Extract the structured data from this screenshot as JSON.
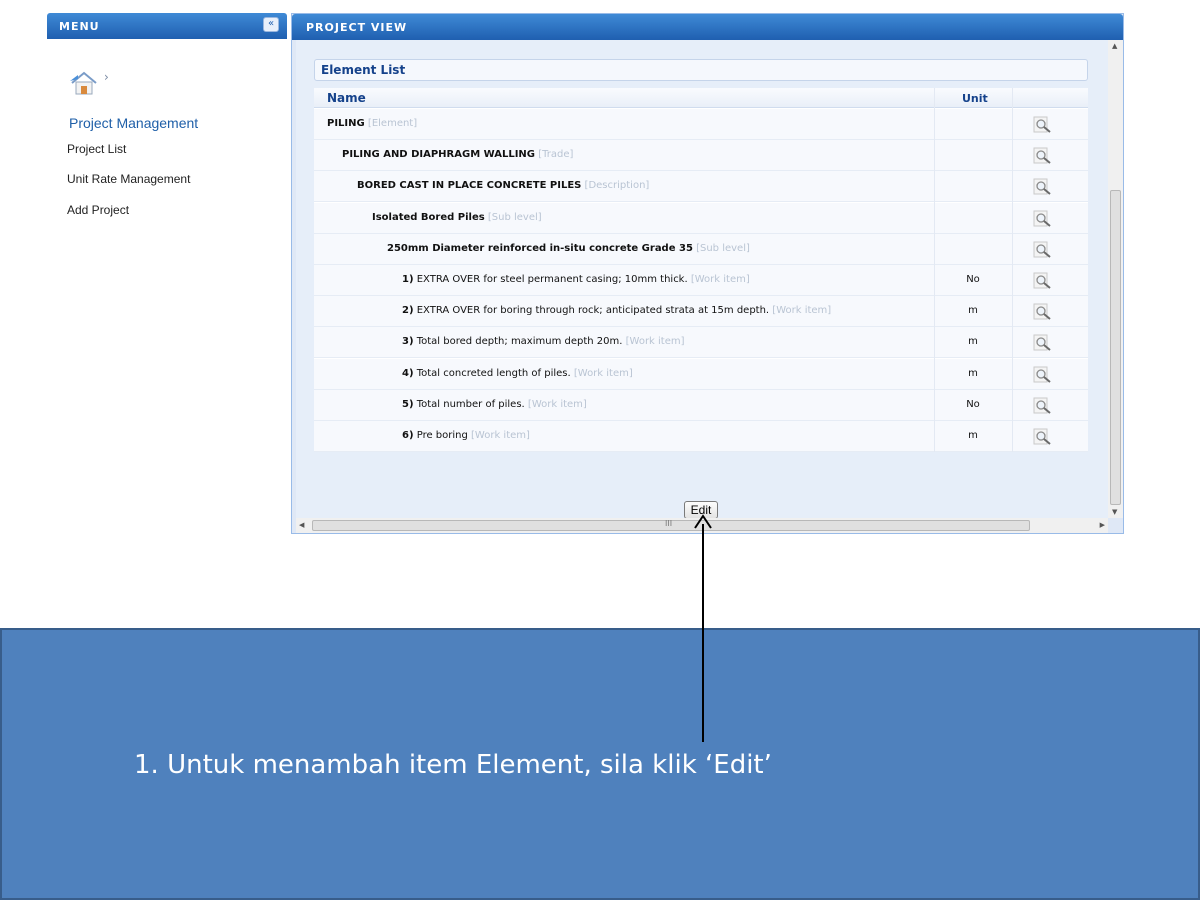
{
  "menu": {
    "title": "MENU",
    "collapse_icon": "double-chevron-left-icon",
    "home_icon": "home-icon",
    "home_chevron": "›",
    "section": "Project Management",
    "links": [
      "Project List",
      "Unit Rate Management",
      "Add Project"
    ]
  },
  "project_view": {
    "title": "PROJECT VIEW",
    "element_list_title": "Element List",
    "columns": {
      "name": "Name",
      "unit": "Unit"
    },
    "rows": [
      {
        "prefix": "",
        "name": "PILING",
        "tag": "[Element]",
        "unit": "",
        "bold": true,
        "level": 0
      },
      {
        "prefix": "",
        "name": "PILING AND DIAPHRAGM WALLING",
        "tag": "[Trade]",
        "unit": "",
        "bold": true,
        "level": 1
      },
      {
        "prefix": "",
        "name": "BORED CAST IN PLACE CONCRETE PILES",
        "tag": "[Description]",
        "unit": "",
        "bold": true,
        "level": 2
      },
      {
        "prefix": "",
        "name": "Isolated Bored Piles",
        "tag": "[Sub level]",
        "unit": "",
        "bold": true,
        "level": 3
      },
      {
        "prefix": "",
        "name": "250mm Diameter reinforced in-situ concrete Grade 35",
        "tag": "[Sub level]",
        "unit": "",
        "bold": true,
        "level": 4
      },
      {
        "prefix": "1)",
        "name": "EXTRA OVER for steel permanent casing; 10mm thick.",
        "tag": "[Work item]",
        "unit": "No",
        "bold": false,
        "level": 5
      },
      {
        "prefix": "2)",
        "name": "EXTRA OVER for boring through rock; anticipated strata at 15m depth.",
        "tag": "[Work item]",
        "unit": "m",
        "bold": false,
        "level": 5
      },
      {
        "prefix": "3)",
        "name": "Total bored depth; maximum depth 20m.",
        "tag": "[Work item]",
        "unit": "m",
        "bold": false,
        "level": 5
      },
      {
        "prefix": "4)",
        "name": "Total concreted length of piles.",
        "tag": "[Work item]",
        "unit": "m",
        "bold": false,
        "level": 5
      },
      {
        "prefix": "5)",
        "name": "Total number of piles.",
        "tag": "[Work item]",
        "unit": "No",
        "bold": false,
        "level": 5
      },
      {
        "prefix": "6)",
        "name": "Pre boring",
        "tag": "[Work item]",
        "unit": "m",
        "bold": false,
        "level": 5
      }
    ],
    "row_icon": "magnifier-icon",
    "edit_label": "Edit",
    "hscroll_grip": "III"
  },
  "annotation": {
    "instruction": "1.   Untuk menambah item Element, sila klik ‘Edit’"
  },
  "colors": {
    "header_blue": "#1f5fb0",
    "panel_bg": "#dfe8f6",
    "annotation_bg": "#4f81bd"
  }
}
